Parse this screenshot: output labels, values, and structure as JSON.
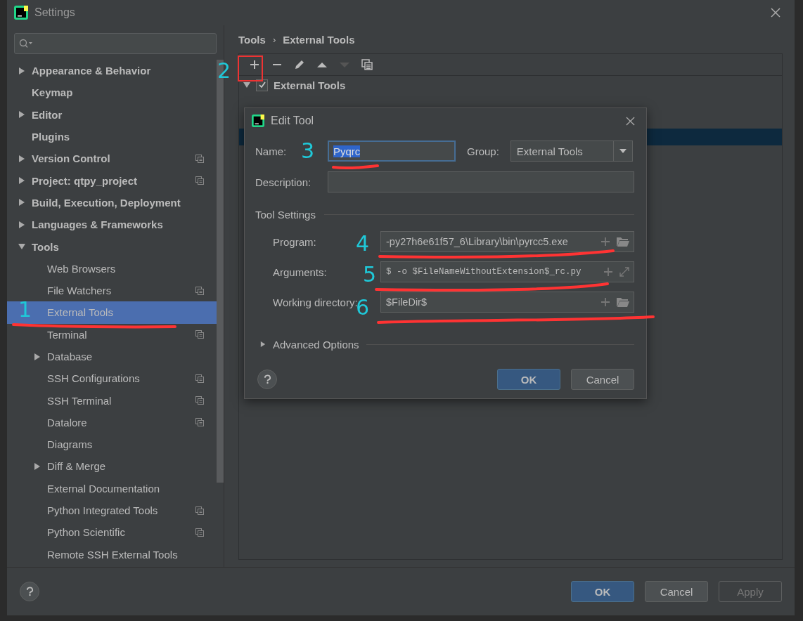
{
  "window": {
    "title": "Settings"
  },
  "sidebar": {
    "items": [
      {
        "label": "Appearance & Behavior",
        "expanded": false,
        "selected": false,
        "project_scoped": false
      },
      {
        "label": "Keymap",
        "selected": false,
        "project_scoped": false
      },
      {
        "label": "Editor",
        "expanded": false,
        "selected": false,
        "project_scoped": false
      },
      {
        "label": "Plugins",
        "selected": false,
        "project_scoped": false
      },
      {
        "label": "Version Control",
        "expanded": false,
        "selected": false,
        "project_scoped": true
      },
      {
        "label": "Project: qtpy_project",
        "expanded": false,
        "selected": false,
        "project_scoped": true
      },
      {
        "label": "Build, Execution, Deployment",
        "expanded": false,
        "selected": false,
        "project_scoped": false
      },
      {
        "label": "Languages & Frameworks",
        "expanded": false,
        "selected": false,
        "project_scoped": false
      },
      {
        "label": "Tools",
        "expanded": true,
        "selected": false,
        "project_scoped": false,
        "children": [
          {
            "label": "Web Browsers",
            "selected": false,
            "project_scoped": false
          },
          {
            "label": "File Watchers",
            "selected": false,
            "project_scoped": true
          },
          {
            "label": "External Tools",
            "selected": true,
            "project_scoped": false
          },
          {
            "label": "Terminal",
            "selected": false,
            "project_scoped": true
          },
          {
            "label": "Database",
            "expanded": false,
            "selected": false,
            "project_scoped": false
          },
          {
            "label": "SSH Configurations",
            "selected": false,
            "project_scoped": true
          },
          {
            "label": "SSH Terminal",
            "selected": false,
            "project_scoped": true
          },
          {
            "label": "Datalore",
            "selected": false,
            "project_scoped": true
          },
          {
            "label": "Diagrams",
            "selected": false,
            "project_scoped": false
          },
          {
            "label": "Diff & Merge",
            "expanded": false,
            "selected": false,
            "project_scoped": false
          },
          {
            "label": "External Documentation",
            "selected": false,
            "project_scoped": false
          },
          {
            "label": "Python Integrated Tools",
            "selected": false,
            "project_scoped": true
          },
          {
            "label": "Python Scientific",
            "selected": false,
            "project_scoped": true
          },
          {
            "label": "Remote SSH External Tools",
            "selected": false,
            "project_scoped": false
          }
        ]
      }
    ]
  },
  "breadcrumb": [
    "Tools",
    "›",
    "External Tools"
  ],
  "toolbar": [
    {
      "kind": "add",
      "disabled": false
    },
    {
      "kind": "remove",
      "disabled": false
    },
    {
      "kind": "edit",
      "disabled": false
    },
    {
      "kind": "up",
      "disabled": false
    },
    {
      "kind": "down",
      "disabled": true
    },
    {
      "kind": "copy",
      "disabled": false
    }
  ],
  "tools_tree": {
    "label": "External Tools",
    "expanded": true,
    "checked": true
  },
  "dialog": {
    "title": "Edit Tool",
    "name": {
      "label": "Name:",
      "value": "Pyqrc",
      "text_selected": true
    },
    "group": {
      "label": "Group:",
      "value": "External Tools"
    },
    "description": {
      "label": "Description:"
    },
    "section": "Tool Settings",
    "fields": [
      {
        "label": "Program:",
        "value": "-py27h6e61f57_6\\Library\\bin\\pyrcc5.exe",
        "kind": "path",
        "monospace": false
      },
      {
        "label": "Arguments:",
        "value": "$ -o $FileNameWithoutExtension$_rc.py",
        "kind": "text",
        "monospace": true
      },
      {
        "label": "Working directory:",
        "value": "$FileDir$",
        "kind": "path",
        "monospace": false
      }
    ],
    "advanced": {
      "label": "Advanced Options",
      "expanded": false
    },
    "buttons": [
      {
        "label": "OK",
        "primary": true
      },
      {
        "label": "Cancel",
        "primary": false
      }
    ]
  },
  "footer": {
    "buttons": [
      {
        "label": "OK",
        "primary": true,
        "disabled": false
      },
      {
        "label": "Cancel",
        "primary": false,
        "disabled": false
      },
      {
        "label": "Apply",
        "primary": false,
        "disabled": true
      }
    ]
  },
  "annotations": [
    {
      "label": "1"
    },
    {
      "label": "2"
    },
    {
      "label": "3"
    },
    {
      "label": "4"
    },
    {
      "label": "5"
    },
    {
      "label": "6"
    }
  ]
}
